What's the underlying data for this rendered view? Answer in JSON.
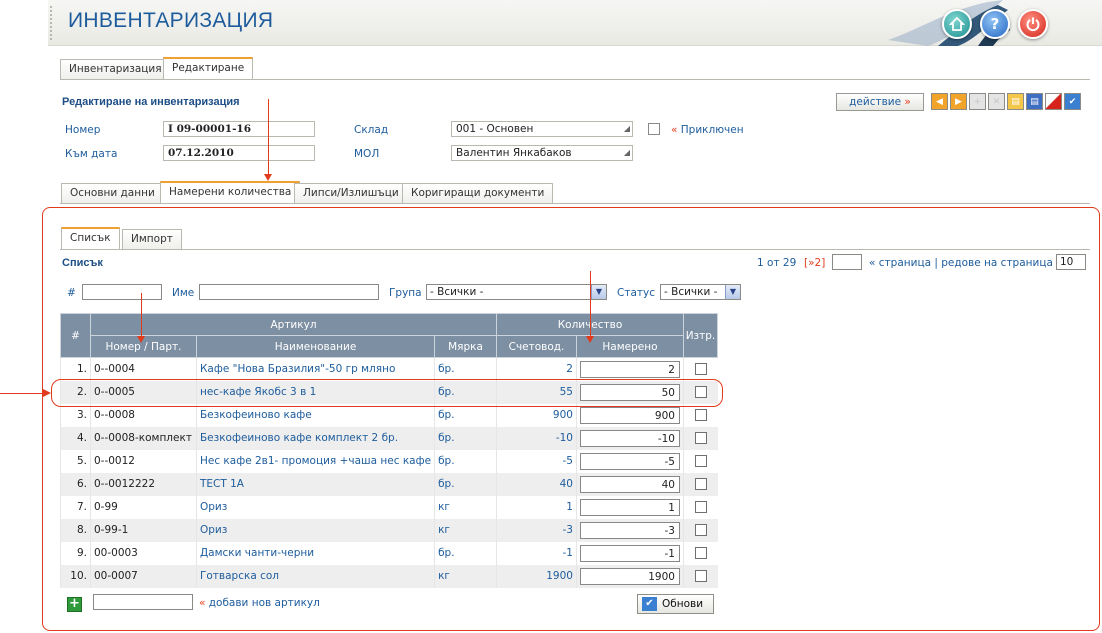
{
  "app": {
    "title": "ИНВЕНТАРИЗАЦИЯ"
  },
  "header_buttons": {
    "home": "home-icon",
    "help": "?",
    "power": "power-icon"
  },
  "top_tabs": [
    "Инвентаризация",
    "Редактиране"
  ],
  "form": {
    "section_title": "Редактиране на инвентаризация",
    "action_label": "действие",
    "number_label": "Номер",
    "number_value": "I 09-00001-16",
    "date_label": "Към дата",
    "date_value": "07.12.2010",
    "warehouse_label": "Склад",
    "warehouse_value": "001 - Основен",
    "mol_label": "МОЛ",
    "mol_value": "Валентин Янкабаков",
    "closed_label": "Приключен"
  },
  "sub_tabs": [
    "Основни данни",
    "Намерени количества",
    "Липси/Излишъци",
    "Коригиращи документи"
  ],
  "list_tabs": [
    "Списък",
    "Импорт"
  ],
  "list": {
    "title": "Списък",
    "pager_text": "1 от 29",
    "pager_next": "[»2]",
    "pager_label": "« страница | редове на страница »",
    "rows_per_page": "10",
    "filter_hash": "#",
    "filter_name": "Име",
    "filter_group": "Група",
    "group_value": "- Всички -",
    "filter_status": "Статус",
    "status_value": "- Всички -"
  },
  "table": {
    "hash": "#",
    "article_group": "Артикул",
    "quantity_group": "Количество",
    "delete": "Изтр.",
    "col_number": "Номер / Парт.",
    "col_name": "Наименование",
    "col_brand": "Мярка",
    "col_accounting": "Счетовод.",
    "col_found": "Намерено",
    "rows": [
      {
        "n": "1.",
        "code": "0--0004",
        "name": "Кафе \"Нова Бразилия\"-50 гр мляно",
        "unit": "бр.",
        "acc": "2",
        "found": "2"
      },
      {
        "n": "2.",
        "code": "0--0005",
        "name": "нес-кафе Якобс 3 в 1",
        "unit": "бр.",
        "acc": "55",
        "found": "50"
      },
      {
        "n": "3.",
        "code": "0--0008",
        "name": "Безкофеиново кафе",
        "unit": "бр.",
        "acc": "900",
        "found": "900"
      },
      {
        "n": "4.",
        "code": "0--0008-комплект",
        "name": "Безкофеиново кафе комплект 2 бр.",
        "unit": "бр.",
        "acc": "-10",
        "found": "-10"
      },
      {
        "n": "5.",
        "code": "0--0012",
        "name": "Нес кафе 2в1- промоция +чаша нес кафе",
        "unit": "бр.",
        "acc": "-5",
        "found": "-5"
      },
      {
        "n": "6.",
        "code": "0--0012222",
        "name": "ТЕСТ 1А",
        "unit": "бр.",
        "acc": "40",
        "found": "40"
      },
      {
        "n": "7.",
        "code": "0-99",
        "name": "Ориз",
        "unit": "кг",
        "acc": "1",
        "found": "1"
      },
      {
        "n": "8.",
        "code": "0-99-1",
        "name": "Ориз",
        "unit": "кг",
        "acc": "-3",
        "found": "-3"
      },
      {
        "n": "9.",
        "code": "00-0003",
        "name": "Дамски чанти-черни",
        "unit": "бр.",
        "acc": "-1",
        "found": "-1"
      },
      {
        "n": "10.",
        "code": "00-0007",
        "name": "Готварска сол",
        "unit": "кг",
        "acc": "1900",
        "found": "1900"
      }
    ]
  },
  "footer": {
    "add_label": "добави нов артикул",
    "update_label": "Обнови"
  },
  "colors": {
    "accent": "#1d5c9c",
    "highlight": "#e23b1b",
    "header_grid": "#7d8fa3"
  }
}
